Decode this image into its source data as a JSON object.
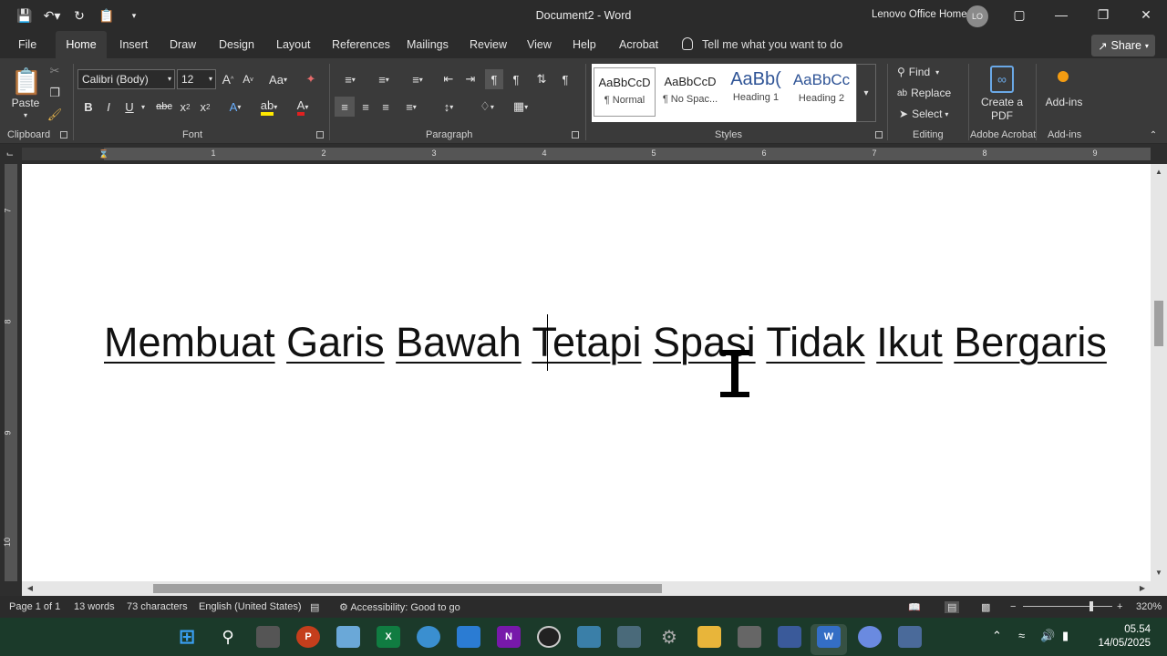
{
  "window": {
    "title": "Document2 - Word",
    "account_name": "Lenovo Office Home",
    "account_initials": "LO"
  },
  "tabs": [
    "File",
    "Home",
    "Insert",
    "Draw",
    "Design",
    "Layout",
    "References",
    "Mailings",
    "Review",
    "View",
    "Help",
    "Acrobat"
  ],
  "active_tab": "Home",
  "tell_me": "Tell me what you want to do",
  "share_label": "Share",
  "ribbon": {
    "clipboard": {
      "label": "Clipboard",
      "paste": "Paste"
    },
    "font": {
      "label": "Font",
      "font_name": "Calibri (Body)",
      "font_size": "12",
      "change_case": "Aa"
    },
    "paragraph": {
      "label": "Paragraph"
    },
    "styles": {
      "label": "Styles",
      "items": [
        {
          "preview": "AaBbCcD",
          "name": "¶ Normal"
        },
        {
          "preview": "AaBbCcD",
          "name": "¶ No Spac..."
        },
        {
          "preview": "AaBb(",
          "name": "Heading 1"
        },
        {
          "preview": "AaBbCc",
          "name": "Heading 2"
        }
      ]
    },
    "editing": {
      "label": "Editing",
      "find": "Find",
      "replace": "Replace",
      "select": "Select"
    },
    "acrobat": {
      "label": "Adobe Acrobat",
      "create_pdf": "Create a PDF"
    },
    "addins": {
      "label": "Add-ins",
      "button": "Add-ins"
    }
  },
  "ruler": {
    "numbers": [
      "1",
      "2",
      "3",
      "4",
      "5",
      "6",
      "7",
      "8",
      "9"
    ],
    "vnumbers": [
      "7",
      "8",
      "9",
      "10"
    ]
  },
  "document": {
    "words": [
      "Membuat",
      "Garis",
      "Bawah",
      "Tetapi",
      "Spasi",
      "Tidak",
      "Ikut",
      "Bergaris"
    ]
  },
  "status": {
    "page": "Page 1 of 1",
    "words": "13 words",
    "chars": "73 characters",
    "language": "English (United States)",
    "accessibility": "Accessibility: Good to go",
    "zoom": "320%"
  },
  "taskbar": {
    "time": "05.54",
    "date": "14/05/2025"
  },
  "colors": {
    "accent_word": "#185abd",
    "taskbar": "#1b3a2a"
  }
}
